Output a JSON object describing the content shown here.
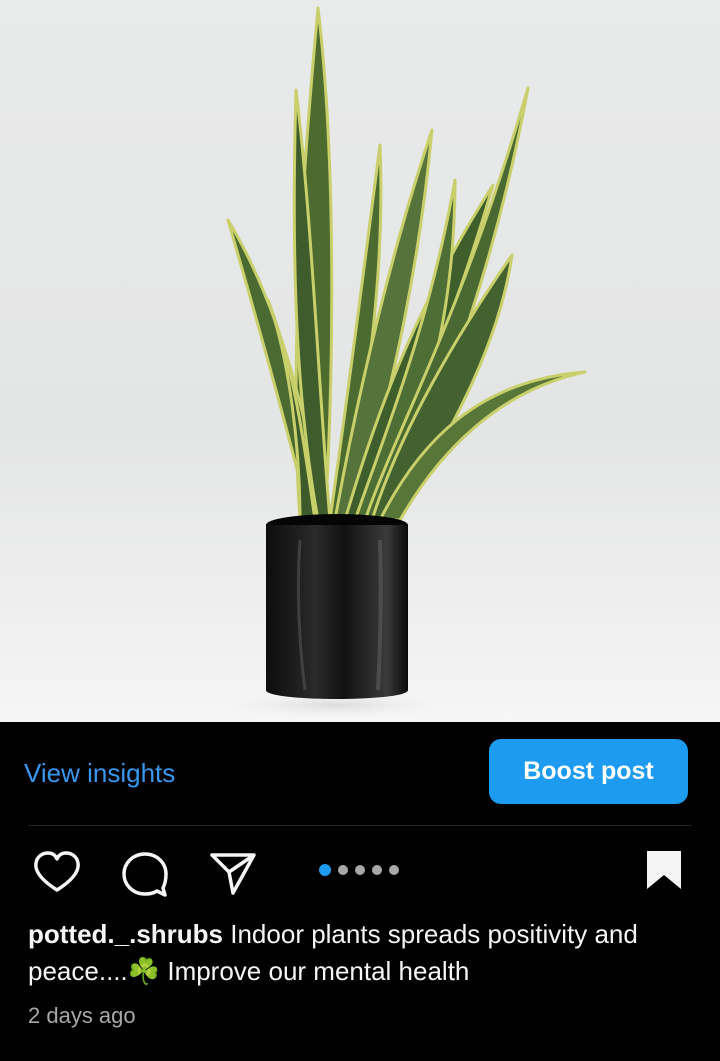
{
  "post": {
    "insights_label": "View insights",
    "boost_label": "Boost post",
    "carousel": {
      "count": 5,
      "active_index": 0
    },
    "username": "potted._.shrubs",
    "caption_part1": "Indoor plants spreads positivity and peace....",
    "caption_emoji": "☘️",
    "caption_part2": "Improve our mental health",
    "timestamp": "2 days ago"
  },
  "colors": {
    "accent": "#1d9bf0",
    "link": "#3897f0",
    "background": "#000000",
    "muted": "#a8a8a8"
  },
  "icons": [
    "heart-icon",
    "comment-icon",
    "paper-plane-icon",
    "bookmark-icon"
  ]
}
